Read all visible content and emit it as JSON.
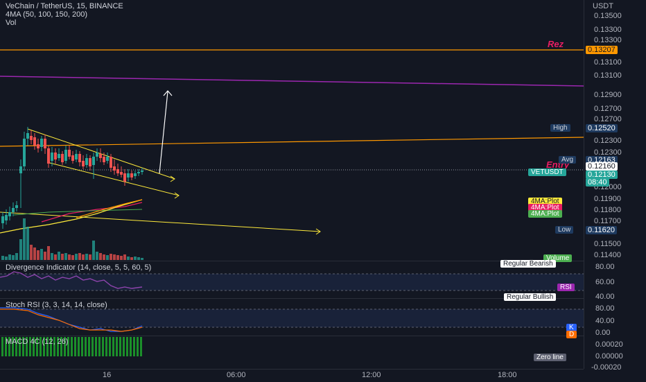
{
  "header": {
    "symbol_line": "VeChain / TetherUS, 15, BINANCE",
    "ma_line": "4MA (50, 100, 150, 200)",
    "vol_line": "Vol"
  },
  "price_axis": {
    "currency": "USDT",
    "ticks": [
      "0.13500",
      "0.13300",
      "0.13100",
      "0.12900",
      "0.12700",
      "0.12500",
      "0.12300",
      "0.12000",
      "0.11900",
      "0.11800",
      "0.11700",
      "0.11500",
      "0.11400"
    ],
    "labels": {
      "rez": "0.13207",
      "high_value": "0.12520",
      "avg_value": "0.12163",
      "last": "0.12160",
      "symbol_value": "0.12130",
      "countdown": "08:40",
      "low_value": "0.11620"
    }
  },
  "tags": {
    "high": "High",
    "avg": "Avg",
    "symbol": "VETUSDT",
    "plot1": "4MA:Plot",
    "plot2": "4MA:Plot",
    "plot3": "4MA:Plot",
    "low": "Low",
    "volume": "Volume",
    "regular_bearish": "Regular Bearish",
    "rsi": "RSI",
    "regular_bullish": "Regular Bullish",
    "k": "K",
    "d": "D",
    "zero_line": "Zero line"
  },
  "annotations": {
    "rez": "Rez",
    "entry": "Entry"
  },
  "divergence_pane": {
    "title": "Divergence Indicator (14, close, 5, 5, 60, 5)",
    "ticks": [
      "80.00",
      "60.00",
      "40.00"
    ]
  },
  "stoch_pane": {
    "title": "Stoch RSI (3, 3, 14, 14, close)",
    "ticks": [
      "80.00",
      "40.00",
      "0.00"
    ]
  },
  "macd_pane": {
    "title": "MACD 4C (12, 26)",
    "ticks": [
      "0.00020",
      "0.00000",
      "-0.00020"
    ]
  },
  "time_axis": {
    "ticks": [
      "16",
      "06:00",
      "12:00",
      "18:00"
    ]
  },
  "colors": {
    "background": "#131722",
    "up": "#26a69a",
    "down": "#ef5350",
    "orange": "#ff9800",
    "purple": "#9c27b0",
    "yellow": "#ffeb3b",
    "pink": "#e91e63"
  }
}
